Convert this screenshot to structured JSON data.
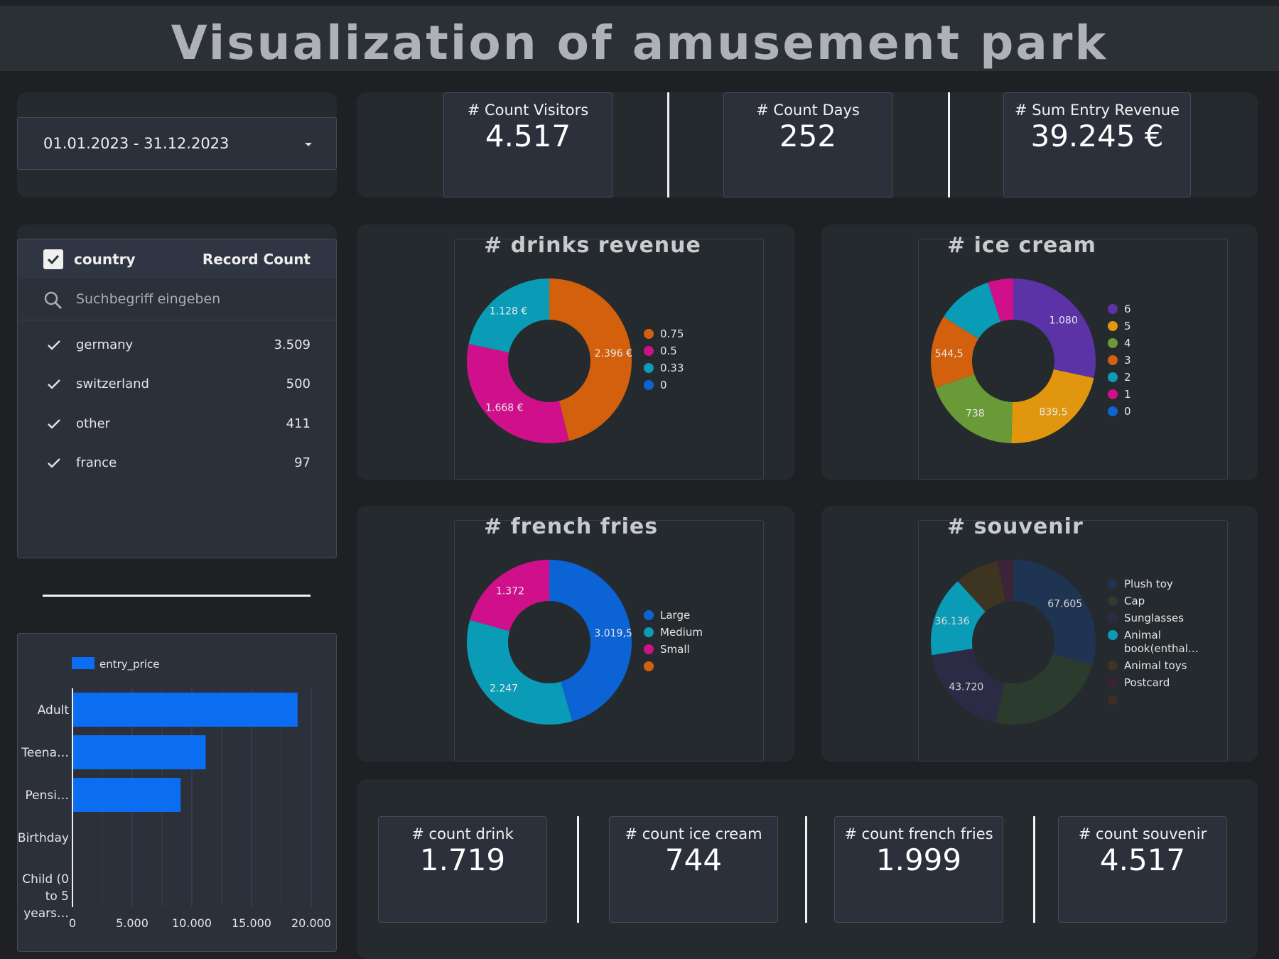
{
  "header": {
    "title": "Visualization of amusement park"
  },
  "date_range": {
    "value": "01.01.2023 - 31.12.2023"
  },
  "kpis_top": [
    {
      "label": "# Count Visitors",
      "value": "4.517"
    },
    {
      "label": "# Count Days",
      "value": "252"
    },
    {
      "label": "# Sum Entry Revenue",
      "value": "39.245 €"
    }
  ],
  "country_filter": {
    "dimension_label": "country",
    "metric_label": "Record Count",
    "search_placeholder": "Suchbegriff eingeben",
    "rows": [
      {
        "label": "germany",
        "count": "3.509"
      },
      {
        "label": "switzerland",
        "count": "500"
      },
      {
        "label": "other",
        "count": "411"
      },
      {
        "label": "france",
        "count": "97"
      }
    ]
  },
  "entry_chart": {
    "legend": "entry_price",
    "categories": [
      "Adult",
      "Teena…",
      "Pensi…",
      "Birthday",
      "Child (0 to 5 years…"
    ],
    "values": [
      18800,
      11100,
      9000,
      0,
      0
    ],
    "xticks": [
      "0",
      "5.000",
      "10.000",
      "15.000",
      "20.000"
    ],
    "color": "#0b6ef2"
  },
  "donuts": {
    "drinks": {
      "title": "# drinks revenue",
      "slices": [
        {
          "name": "0.75",
          "value": 2396,
          "label": "2.396 €",
          "color": "#d2600c"
        },
        {
          "name": "0.5",
          "value": 1668,
          "label": "1.668 €",
          "color": "#d0108a"
        },
        {
          "name": "0.33",
          "value": 1128,
          "label": "1.128 €",
          "color": "#0a9cb6"
        },
        {
          "name": "0",
          "value": 0,
          "label": "",
          "color": "#0c63d4"
        }
      ]
    },
    "icecream": {
      "title": "# ice cream",
      "slices": [
        {
          "name": "6",
          "value": 1080,
          "label": "1.080",
          "color": "#5b33a6"
        },
        {
          "name": "5",
          "value": 839.5,
          "label": "839,5",
          "color": "#e0970d"
        },
        {
          "name": "4",
          "value": 738,
          "label": "738",
          "color": "#6a9a38"
        },
        {
          "name": "3",
          "value": 544.5,
          "label": "544,5",
          "color": "#d2600c"
        },
        {
          "name": "2",
          "value": 420,
          "label": "",
          "color": "#0a9cb6"
        },
        {
          "name": "1",
          "value": 190,
          "label": "",
          "color": "#d0108a"
        },
        {
          "name": "0",
          "value": 0,
          "label": "",
          "color": "#0c63d4"
        }
      ]
    },
    "fries": {
      "title": "# french fries",
      "slices": [
        {
          "name": "Large",
          "value": 3019.5,
          "label": "3.019,5",
          "color": "#0c63d4"
        },
        {
          "name": "Medium",
          "value": 2247,
          "label": "2.247",
          "color": "#0a9cb6"
        },
        {
          "name": "Small",
          "value": 1372,
          "label": "1.372",
          "color": "#d0108a"
        },
        {
          "name": "",
          "value": 0,
          "label": "",
          "color": "#d2600c"
        }
      ]
    },
    "souvenir": {
      "title": "# souvenir",
      "slices": [
        {
          "name": "Plush toy",
          "value": 67605,
          "label": "67.605",
          "color": "#1f3352"
        },
        {
          "name": "Cap",
          "value": 55000,
          "label": "",
          "color": "#2b3b2e"
        },
        {
          "name": "Sunglasses",
          "value": 43720,
          "label": "43.720",
          "color": "#2c2a44"
        },
        {
          "name": "Animal book(enthal…",
          "value": 36136,
          "label": "36.136",
          "color": "#0a9cb6"
        },
        {
          "name": "Animal toys",
          "value": 20000,
          "label": "",
          "color": "#3d3522"
        },
        {
          "name": "Postcard",
          "value": 7000,
          "label": "",
          "color": "#3d2337"
        },
        {
          "name": "",
          "value": 0,
          "label": "",
          "color": "#3d2d25"
        }
      ]
    }
  },
  "kpis_bottom": [
    {
      "label": "# count drink",
      "value": "1.719"
    },
    {
      "label": "# count ice cream",
      "value": "744"
    },
    {
      "label": "# count french fries",
      "value": "1.999"
    },
    {
      "label": "# count souvenir",
      "value": "4.517"
    }
  ]
}
